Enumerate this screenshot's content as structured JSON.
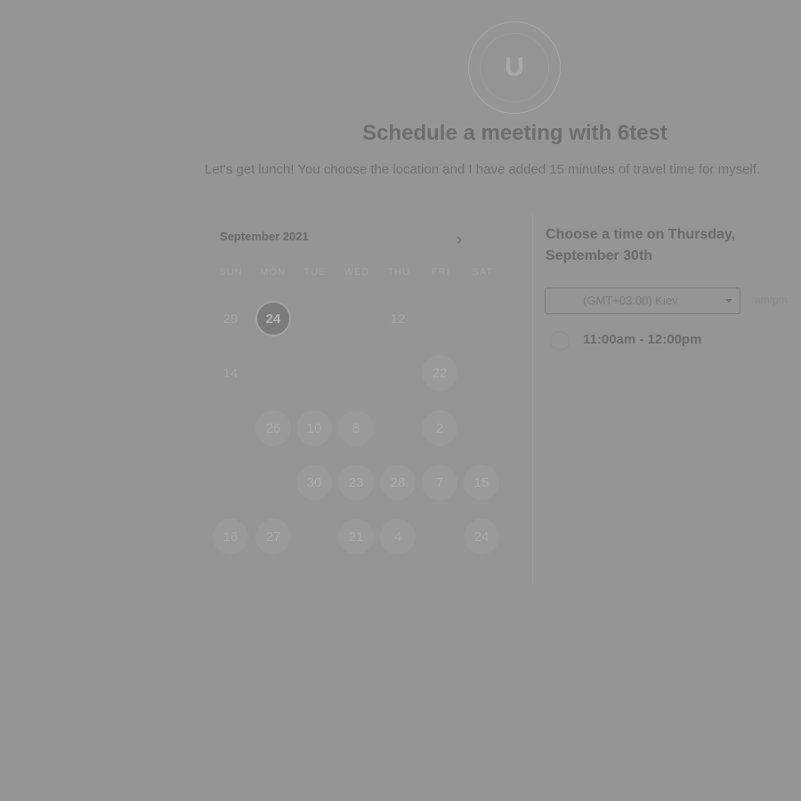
{
  "header": {
    "avatar_letter": "U",
    "title": "Schedule a meeting with 6test",
    "description": "Let's get lunch! You choose the location and I have added 15 minutes of travel time for myself."
  },
  "calendar": {
    "month_label": "September 2021",
    "next_icon": "chevron-right-icon",
    "weekdays": [
      "SUN",
      "MON",
      "TUE",
      "WED",
      "THU",
      "FRI",
      "SAT"
    ],
    "days": [
      {
        "label": "29",
        "avail": false
      },
      {
        "label": "24",
        "avail": true,
        "selected": true
      },
      {
        "label": "12",
        "avail": false
      },
      {
        "label": "14",
        "avail": false
      },
      {
        "label": "22",
        "avail": true
      },
      {
        "label": "26",
        "avail": true
      },
      {
        "label": "10",
        "avail": true
      },
      {
        "label": "8",
        "avail": true
      },
      {
        "label": "2",
        "avail": true
      },
      {
        "label": "30",
        "avail": true
      },
      {
        "label": "23",
        "avail": true
      },
      {
        "label": "28",
        "avail": true
      },
      {
        "label": "7",
        "avail": true
      },
      {
        "label": "15",
        "avail": true
      },
      {
        "label": "16",
        "avail": true
      },
      {
        "label": "27",
        "avail": true
      },
      {
        "label": "21",
        "avail": true
      },
      {
        "label": "4",
        "avail": true
      },
      {
        "label": "24",
        "avail": true
      }
    ]
  },
  "times": {
    "heading": "Choose a time on Thursday, September 30th",
    "timezone": "(GMT+03:00) Kiev",
    "ampm_toggle": "am/pm",
    "slots": [
      {
        "label": "11:00am - 12:00pm"
      }
    ]
  }
}
